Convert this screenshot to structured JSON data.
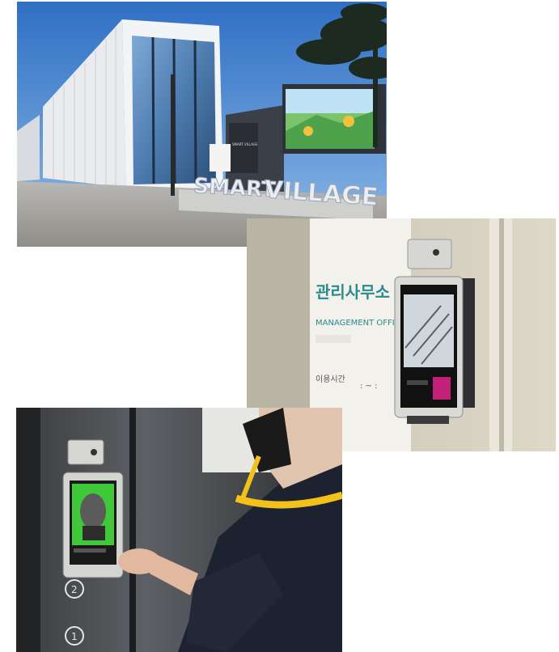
{
  "photo1": {
    "sign_word_1": "SMART",
    "sign_word_2": "VILLAGE",
    "board_line_1": "SMART VILLAGE"
  },
  "photo2": {
    "room_name_ko": "관리사무소",
    "room_name_en": "MANAGEMENT OFFI",
    "hours_label": "이용시간",
    "hours_value": ":  ~  :"
  },
  "photo3": {
    "floor_2": "2",
    "floor_1": "1"
  },
  "colors": {
    "sky": "#3d7fd0",
    "lanyard": "#f2c21a",
    "screen_green": "#3fc83a",
    "sign_blue": "#1f5f9c"
  }
}
